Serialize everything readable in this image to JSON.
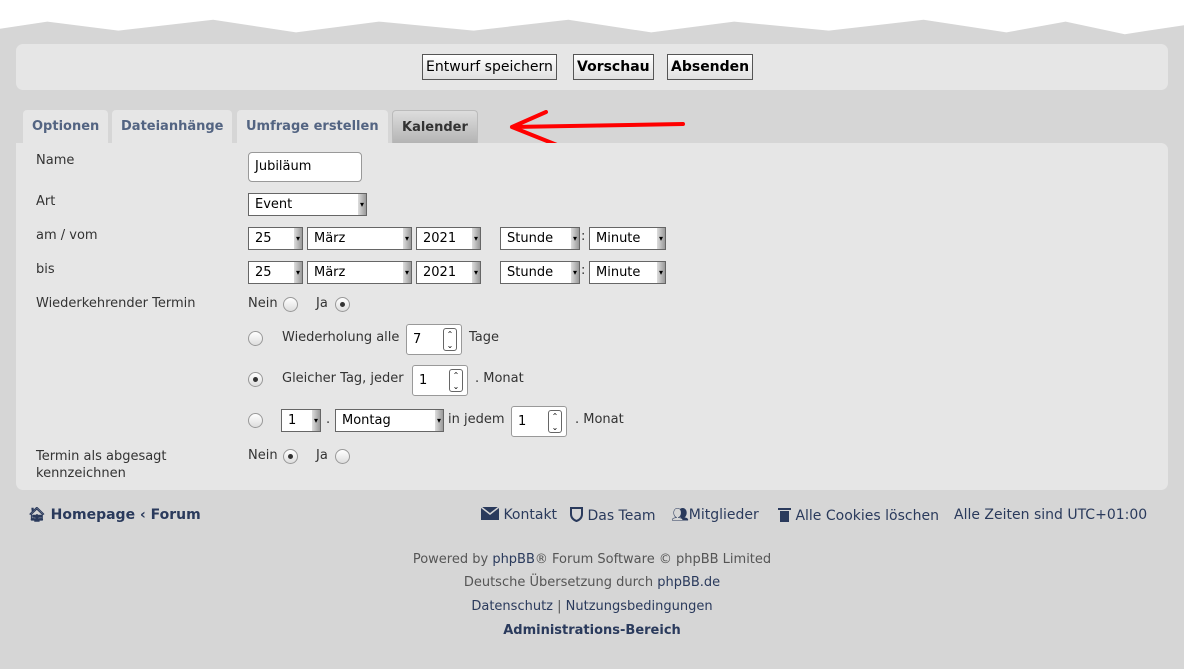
{
  "buttons": {
    "save_draft": "Entwurf speichern",
    "preview": "Vorschau",
    "submit": "Absenden"
  },
  "tabs": [
    {
      "label": "Optionen"
    },
    {
      "label": "Dateianhänge"
    },
    {
      "label": "Umfrage erstellen"
    },
    {
      "label": "Kalender",
      "active": true
    }
  ],
  "form": {
    "name": {
      "label": "Name",
      "value": "Jubiläum"
    },
    "type": {
      "label": "Art",
      "value": "Event"
    },
    "start": {
      "label": "am / vom",
      "day": "25",
      "month": "März",
      "year": "2021",
      "hour": "Stunde",
      "minute": "Minute"
    },
    "end": {
      "label": "bis",
      "day": "25",
      "month": "März",
      "year": "2021",
      "hour": "Stunde",
      "minute": "Minute"
    },
    "recurring": {
      "label": "Wiederkehrender Termin",
      "no": "Nein",
      "yes": "Ja",
      "selected": "Ja",
      "opt1": {
        "prefix": "Wiederholung alle",
        "value": "7",
        "suffix": "Tage",
        "selected": false
      },
      "opt2": {
        "prefix": "Gleicher Tag, jeder",
        "value": "1",
        "suffix": ". Monat",
        "selected": true
      },
      "opt3": {
        "week": "1",
        "dot": ".",
        "weekday": "Montag",
        "middle": "in jedem",
        "value": "1",
        "suffix": ". Monat",
        "selected": false
      }
    },
    "cancelled": {
      "label1": "Termin als abgesagt",
      "label2": "kennzeichnen",
      "no": "Nein",
      "yes": "Ja",
      "selected": "Nein"
    },
    "colon": ":"
  },
  "footer": {
    "breadcrumb": {
      "home": "Homepage",
      "sep": "‹",
      "forum": "Forum"
    },
    "links": {
      "contact": "Kontakt",
      "team": "Das Team",
      "members": "Mitglieder",
      "cookies": "Alle Cookies löschen",
      "timezone": "Alle Zeiten sind UTC+01:00"
    },
    "powered_pre": "Powered by ",
    "powered_link": "phpBB",
    "powered_post": "® Forum Software © phpBB Limited",
    "translation_pre": "Deutsche Übersetzung durch ",
    "translation_link": "phpBB.de",
    "privacy": "Datenschutz",
    "pipe": "|",
    "terms": "Nutzungsbedingungen",
    "admin": "Administrations-Bereich"
  },
  "colors": {
    "accent_link": "#2a3a5c",
    "tab_text": "#536482",
    "annotation_arrow": "#ff0000"
  },
  "icons": {
    "home": "home-icon",
    "contact": "envelope-icon",
    "team": "shield-icon",
    "members": "users-icon",
    "cookies": "trash-icon"
  }
}
